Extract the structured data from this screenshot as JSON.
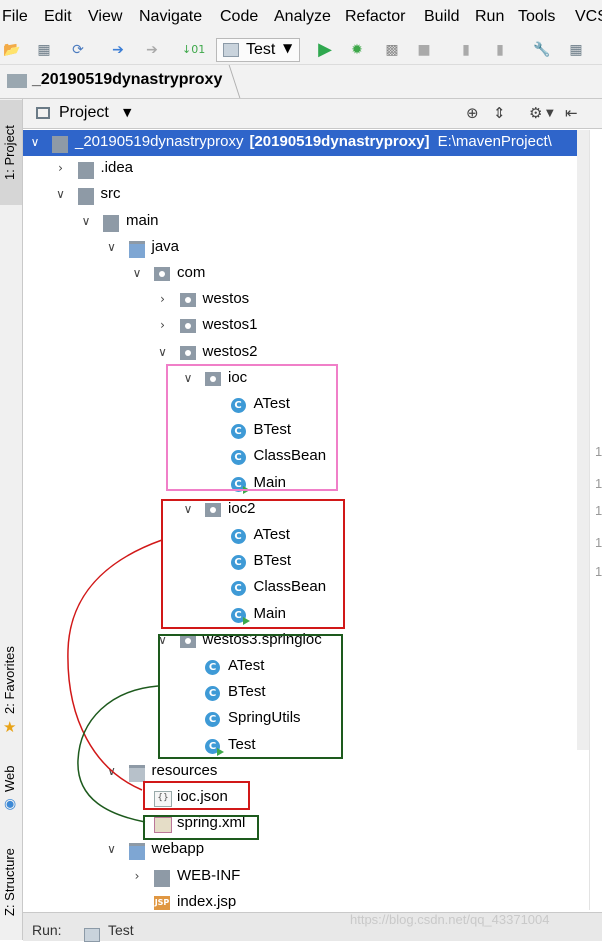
{
  "menu": [
    "File",
    "Edit",
    "View",
    "Navigate",
    "Code",
    "Analyze",
    "Refactor",
    "Build",
    "Run",
    "Tools",
    "VCS"
  ],
  "toolbar": {
    "run_config": "Test"
  },
  "breadcrumb": "_20190519dynastryproxy",
  "side_tabs": {
    "project": "1: Project",
    "favorites": "2: Favorites",
    "web": "Web",
    "structure": "Z: Structure"
  },
  "panel": {
    "title": "Project"
  },
  "tree": [
    {
      "label": "_20190519dynastryproxy",
      "extra": "[20190519dynastryproxy]",
      "path": "E:\\mavenProject\\",
      "icon": "module-folder",
      "depth": 0,
      "expanded": true,
      "selected": true
    },
    {
      "label": ".idea",
      "icon": "folder",
      "depth": 1,
      "expanded": false
    },
    {
      "label": "src",
      "icon": "folder",
      "depth": 1,
      "expanded": true
    },
    {
      "label": "main",
      "icon": "folder",
      "depth": 2,
      "expanded": true
    },
    {
      "label": "java",
      "icon": "source-folder",
      "depth": 3,
      "expanded": true
    },
    {
      "label": "com",
      "icon": "package",
      "depth": 4,
      "expanded": true
    },
    {
      "label": "westos",
      "icon": "package",
      "depth": 5,
      "expanded": false
    },
    {
      "label": "westos1",
      "icon": "package",
      "depth": 5,
      "expanded": false
    },
    {
      "label": "westos2",
      "icon": "package",
      "depth": 5,
      "expanded": true
    },
    {
      "label": "ioc",
      "icon": "package",
      "depth": 6,
      "expanded": true
    },
    {
      "label": "ATest",
      "icon": "class",
      "depth": 7
    },
    {
      "label": "BTest",
      "icon": "class",
      "depth": 7
    },
    {
      "label": "ClassBean",
      "icon": "class",
      "depth": 7
    },
    {
      "label": "Main",
      "icon": "main-class",
      "depth": 7
    },
    {
      "label": "ioc2",
      "icon": "package",
      "depth": 6,
      "expanded": true
    },
    {
      "label": "ATest",
      "icon": "class",
      "depth": 7
    },
    {
      "label": "BTest",
      "icon": "class",
      "depth": 7
    },
    {
      "label": "ClassBean",
      "icon": "class",
      "depth": 7
    },
    {
      "label": "Main",
      "icon": "main-class",
      "depth": 7
    },
    {
      "label": "westos3.springioc",
      "icon": "package",
      "depth": 5,
      "expanded": true
    },
    {
      "label": "ATest",
      "icon": "class",
      "depth": 6
    },
    {
      "label": "BTest",
      "icon": "class",
      "depth": 6
    },
    {
      "label": "SpringUtils",
      "icon": "class",
      "depth": 6
    },
    {
      "label": "Test",
      "icon": "main-class",
      "depth": 6
    },
    {
      "label": "resources",
      "icon": "resources-folder",
      "depth": 3,
      "expanded": true
    },
    {
      "label": "ioc.json",
      "icon": "json-file",
      "depth": 4
    },
    {
      "label": "spring.xml",
      "icon": "xml-file",
      "depth": 4
    },
    {
      "label": "webapp",
      "icon": "web-folder",
      "depth": 3,
      "expanded": true
    },
    {
      "label": "WEB-INF",
      "icon": "folder",
      "depth": 4,
      "expanded": false
    },
    {
      "label": "index.jsp",
      "icon": "jsp-file",
      "depth": 4
    }
  ],
  "gutter_numbers": [
    "1",
    "1",
    "1",
    "1",
    "1"
  ],
  "bottom": {
    "run_tab": "Run:",
    "test_tab": "Test"
  },
  "watermark": "https://blog.csdn.net/qq_43371004",
  "annotation_colors": {
    "pink": "#f07fc8",
    "red": "#d11818",
    "green": "#1d5a1d"
  }
}
